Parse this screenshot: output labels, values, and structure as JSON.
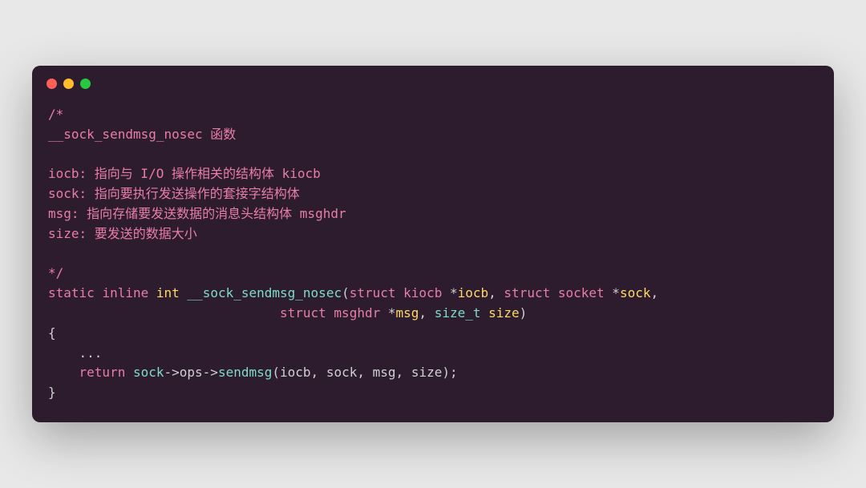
{
  "code": {
    "comment_open": "/*",
    "comment_line1": "__sock_sendmsg_nosec 函数",
    "comment_blank": "",
    "comment_iocb": "iocb: 指向与 I/O 操作相关的结构体 kiocb",
    "comment_sock": "sock: 指向要执行发送操作的套接字结构体",
    "comment_msg": "msg: 指向存储要发送数据的消息头结构体 msghdr",
    "comment_size": "size: 要发送的数据大小",
    "comment_close": "*/",
    "kw_static": "static",
    "kw_inline": "inline",
    "kw_int": "int",
    "func_name": "__sock_sendmsg_nosec",
    "kw_struct1": "struct",
    "type_kiocb": "kiocb",
    "star1": "*",
    "param_iocb": "iocb",
    "comma1": ",",
    "kw_struct2": "struct",
    "type_socket": "socket",
    "star2": "*",
    "param_sock": "sock",
    "comma2": ",",
    "kw_struct3": "struct",
    "type_msghdr": "msghdr",
    "star3": "*",
    "param_msg": "msg",
    "comma3": ",",
    "type_sizet": "size_t",
    "param_size": "size",
    "paren_close": ")",
    "brace_open": "{",
    "ellipsis": "    ...",
    "kw_return": "return",
    "id_sock": "sock",
    "arrow1": "->",
    "id_ops": "ops",
    "arrow2": "->",
    "method_sendmsg": "sendmsg",
    "paren_open2": "(",
    "arg_iocb": "iocb",
    "comma4": ",",
    "arg_sock": "sock",
    "comma5": ",",
    "arg_msg": "msg",
    "comma6": ",",
    "arg_size": "size",
    "paren_close2": ")",
    "semi": ";",
    "brace_close": "}",
    "indent_line2": "                              ",
    "indent_return": "    ",
    "paren_open1": "("
  }
}
